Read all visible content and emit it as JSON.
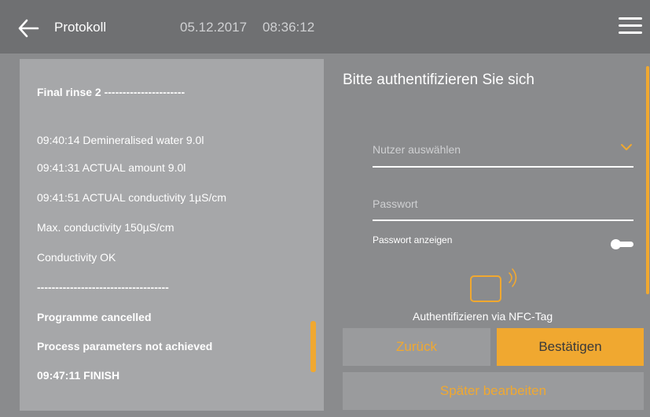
{
  "header": {
    "title": "Protokoll",
    "date": "05.12.2017",
    "time": "08:36:12"
  },
  "log": {
    "lines": [
      {
        "text": "Final rinse 2 ----------------------",
        "bold": true
      },
      {
        "text": "09:40:14 Demineralised water 9.0l",
        "bold": false
      },
      {
        "text": "09:41:31 ACTUAL amount 9.0l",
        "bold": false
      },
      {
        "text": "09:41:51 ACTUAL conductivity 1µS/cm",
        "bold": false
      },
      {
        "text": "Max. conductivity 150µS/cm",
        "bold": false
      },
      {
        "text": "Conductivity OK",
        "bold": false
      },
      {
        "text": "------------------------------------",
        "bold": true
      },
      {
        "text": "Programme cancelled",
        "bold": true
      },
      {
        "text": "Process parameters not achieved",
        "bold": true
      },
      {
        "text": "09:47:11 FINISH",
        "bold": true
      }
    ]
  },
  "auth": {
    "title": "Bitte authentifizieren Sie sich",
    "user_placeholder": "Nutzer auswählen",
    "password_placeholder": "Passwort",
    "show_password_label": "Passwort anzeigen",
    "nfc_label": "Authentifizieren via NFC-Tag"
  },
  "buttons": {
    "back": "Zurück",
    "confirm": "Bestätigen",
    "later": "Später bearbeiten"
  },
  "colors": {
    "accent": "#f0a830",
    "header_bg": "#6f7072",
    "page_bg": "#8a8b8d",
    "log_bg": "#a6a7a9"
  },
  "icons": {
    "back": "arrow-left-icon",
    "menu": "hamburger-menu-icon",
    "dropdown": "chevron-down-icon",
    "nfc": "nfc-card-icon"
  }
}
